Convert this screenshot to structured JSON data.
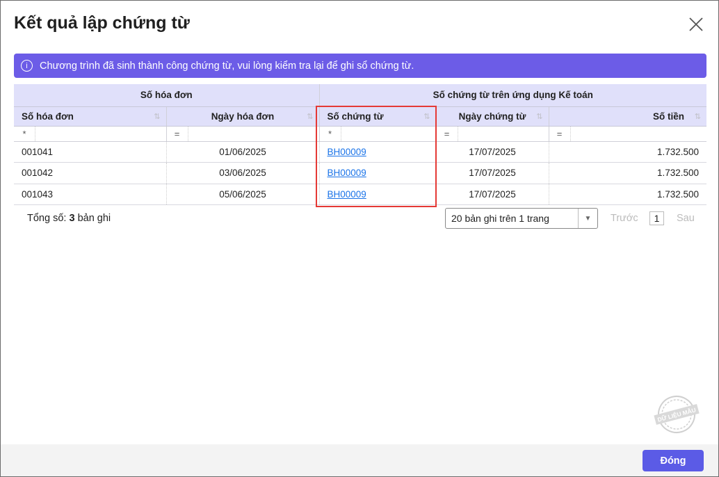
{
  "dialog": {
    "title": "Kết quả lập chứng từ",
    "banner": "Chương trình đã sinh thành công chứng từ, vui lòng kiểm tra lại để ghi sổ chứng từ.",
    "info_icon": "i",
    "close_label": "Đóng",
    "watermark": "DỮ LIỆU MẪU"
  },
  "table": {
    "groups": [
      "Số hóa đơn",
      "Số chứng từ trên ứng dụng Kế toán"
    ],
    "columns": [
      "Số hóa đơn",
      "Ngày hóa đơn",
      "Số chứng từ",
      "Ngày chứng từ",
      "Số tiền"
    ],
    "filters": [
      "*",
      "=",
      "*",
      "=",
      "="
    ],
    "rows": [
      [
        "001041",
        "01/06/2025",
        "BH00009",
        "17/07/2025",
        "1.732.500"
      ],
      [
        "001042",
        "03/06/2025",
        "BH00009",
        "17/07/2025",
        "1.732.500"
      ],
      [
        "001043",
        "05/06/2025",
        "BH00009",
        "17/07/2025",
        "1.732.500"
      ]
    ]
  },
  "footer": {
    "total_prefix": "Tổng số:",
    "total_count": "3",
    "total_suffix": "bản ghi",
    "page_size": "20 bản ghi trên 1 trang",
    "prev": "Trước",
    "page": "1",
    "next": "Sau"
  },
  "colors": {
    "accent": "#6c5ce7",
    "button": "#5b5be6",
    "highlight": "#e53935"
  }
}
